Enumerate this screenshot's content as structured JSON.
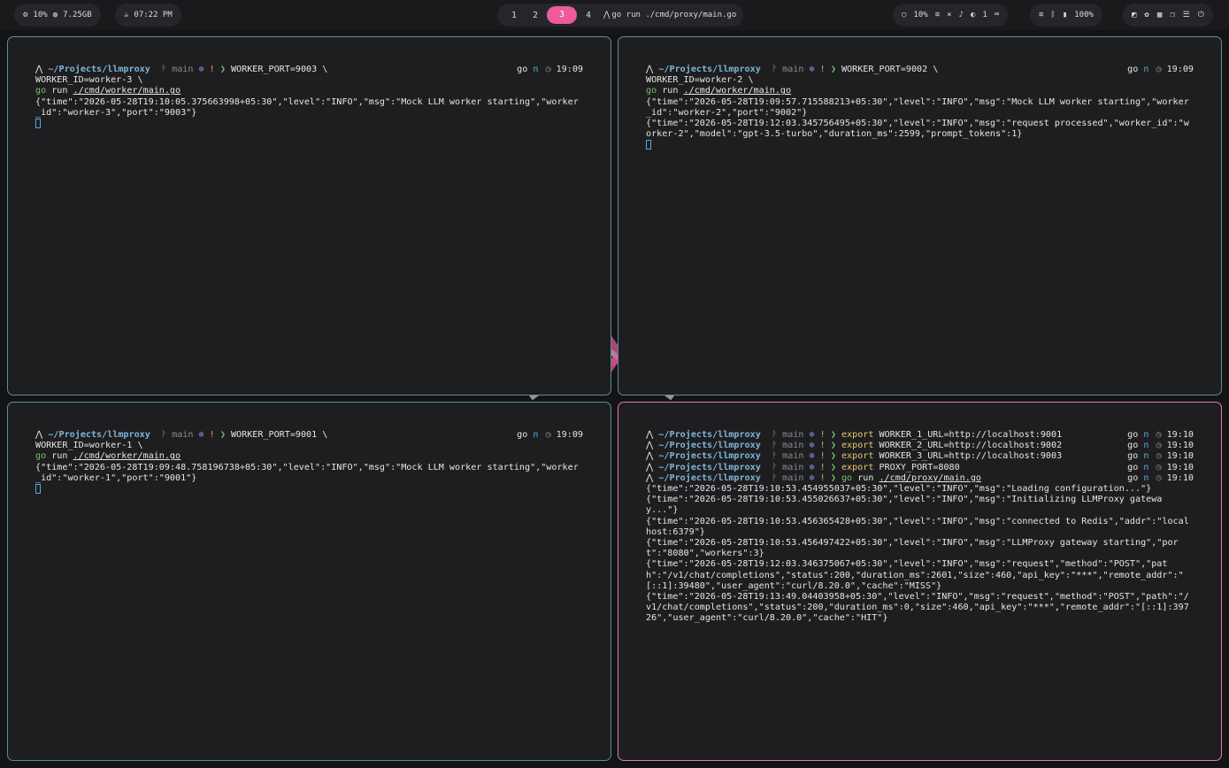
{
  "topbar": {
    "left1": {
      "cpu": "10%",
      "mem": "7.25GB"
    },
    "left2": {
      "clock": "07:22 PM"
    },
    "workspaces": [
      "1",
      "2",
      "3",
      "4"
    ],
    "active_workspace": "3",
    "window_title": "go run ./cmd/proxy/main.go",
    "right1": {
      "brightness": "10%",
      "dnd": "1"
    },
    "right2": {
      "battery": "100%"
    }
  },
  "panes": {
    "tl": {
      "prompt": {
        "path": "~/Projects/llmproxy",
        "branch": "main",
        "cmd": "WORKER_PORT=9003 \\",
        "right_go": "go",
        "right_n": "n",
        "right_time": "19:09"
      },
      "line2": "WORKER_ID=worker-3 \\",
      "line3_kw": "go",
      "line3_cmd": "run",
      "line3_arg": "./cmd/worker/main.go",
      "out": "{\"time\":\"2026-05-28T19:10:05.375663998+05:30\",\"level\":\"INFO\",\"msg\":\"Mock LLM worker starting\",\"worker_id\":\"worker-3\",\"port\":\"9003\"}"
    },
    "tr": {
      "prompt": {
        "path": "~/Projects/llmproxy",
        "branch": "main",
        "cmd": "WORKER_PORT=9002 \\",
        "right_go": "go",
        "right_n": "n",
        "right_time": "19:09"
      },
      "line2": "WORKER_ID=worker-2 \\",
      "line3_kw": "go",
      "line3_cmd": "run",
      "line3_arg": "./cmd/worker/main.go",
      "out1": "{\"time\":\"2026-05-28T19:09:57.715588213+05:30\",\"level\":\"INFO\",\"msg\":\"Mock LLM worker starting\",\"worker_id\":\"worker-2\",\"port\":\"9002\"}",
      "out2": "{\"time\":\"2026-05-28T19:12:03.345756495+05:30\",\"level\":\"INFO\",\"msg\":\"request processed\",\"worker_id\":\"worker-2\",\"model\":\"gpt-3.5-turbo\",\"duration_ms\":2599,\"prompt_tokens\":1}"
    },
    "bl": {
      "prompt": {
        "path": "~/Projects/llmproxy",
        "branch": "main",
        "cmd": "WORKER_PORT=9001 \\",
        "right_go": "go",
        "right_n": "n",
        "right_time": "19:09"
      },
      "line2": "WORKER_ID=worker-1 \\",
      "line3_kw": "go",
      "line3_cmd": "run",
      "line3_arg": "./cmd/worker/main.go",
      "out": "{\"time\":\"2026-05-28T19:09:48.758196738+05:30\",\"level\":\"INFO\",\"msg\":\"Mock LLM worker starting\",\"worker_id\":\"worker-1\",\"port\":\"9001\"}"
    },
    "br": {
      "prompts": [
        {
          "path": "~/Projects/llmproxy",
          "branch": "main",
          "cmd": "export",
          "arg": "WORKER_1_URL=http://localhost:9001",
          "right_go": "go",
          "right_n": "n",
          "right_time": "19:10"
        },
        {
          "path": "~/Projects/llmproxy",
          "branch": "main",
          "cmd": "export",
          "arg": "WORKER_2_URL=http://localhost:9002",
          "right_go": "go",
          "right_n": "n",
          "right_time": "19:10"
        },
        {
          "path": "~/Projects/llmproxy",
          "branch": "main",
          "cmd": "export",
          "arg": "WORKER_3_URL=http://localhost:9003",
          "right_go": "go",
          "right_n": "n",
          "right_time": "19:10"
        },
        {
          "path": "~/Projects/llmproxy",
          "branch": "main",
          "cmd": "export",
          "arg": "PROXY_PORT=8080",
          "right_go": "go",
          "right_n": "n",
          "right_time": "19:10"
        },
        {
          "path": "~/Projects/llmproxy",
          "branch": "main",
          "cmd": "go",
          "arg": "run",
          "arg2": "./cmd/proxy/main.go",
          "right_go": "go",
          "right_n": "n",
          "right_time": "19:10"
        }
      ],
      "out": [
        "{\"time\":\"2026-05-28T19:10:53.454955037+05:30\",\"level\":\"INFO\",\"msg\":\"Loading configuration...\"}",
        "{\"time\":\"2026-05-28T19:10:53.455026637+05:30\",\"level\":\"INFO\",\"msg\":\"Initializing LLMProxy gateway...\"}",
        "{\"time\":\"2026-05-28T19:10:53.456365428+05:30\",\"level\":\"INFO\",\"msg\":\"connected to Redis\",\"addr\":\"localhost:6379\"}",
        "{\"time\":\"2026-05-28T19:10:53.456497422+05:30\",\"level\":\"INFO\",\"msg\":\"LLMProxy gateway starting\",\"port\":\"8080\",\"workers\":3}",
        "{\"time\":\"2026-05-28T19:12:03.346375067+05:30\",\"level\":\"INFO\",\"msg\":\"request\",\"method\":\"POST\",\"path\":\"/v1/chat/completions\",\"status\":200,\"duration_ms\":2601,\"size\":460,\"api_key\":\"***\",\"remote_addr\":\"[::1]:39480\",\"user_agent\":\"curl/8.20.0\",\"cache\":\"MISS\"}",
        "{\"time\":\"2026-05-28T19:13:49.04403958+05:30\",\"level\":\"INFO\",\"msg\":\"request\",\"method\":\"POST\",\"path\":\"/v1/chat/completions\",\"status\":200,\"duration_ms\":0,\"size\":460,\"api_key\":\"***\",\"remote_addr\":\"[::1]:39726\",\"user_agent\":\"curl/8.20.0\",\"cache\":\"HIT\"}"
      ]
    }
  },
  "colors": {
    "accent": "#ee5a9c",
    "pane_border": "#5c8c97",
    "pane_border_focused": "#e07ba6",
    "path": "#7fb6d8"
  }
}
